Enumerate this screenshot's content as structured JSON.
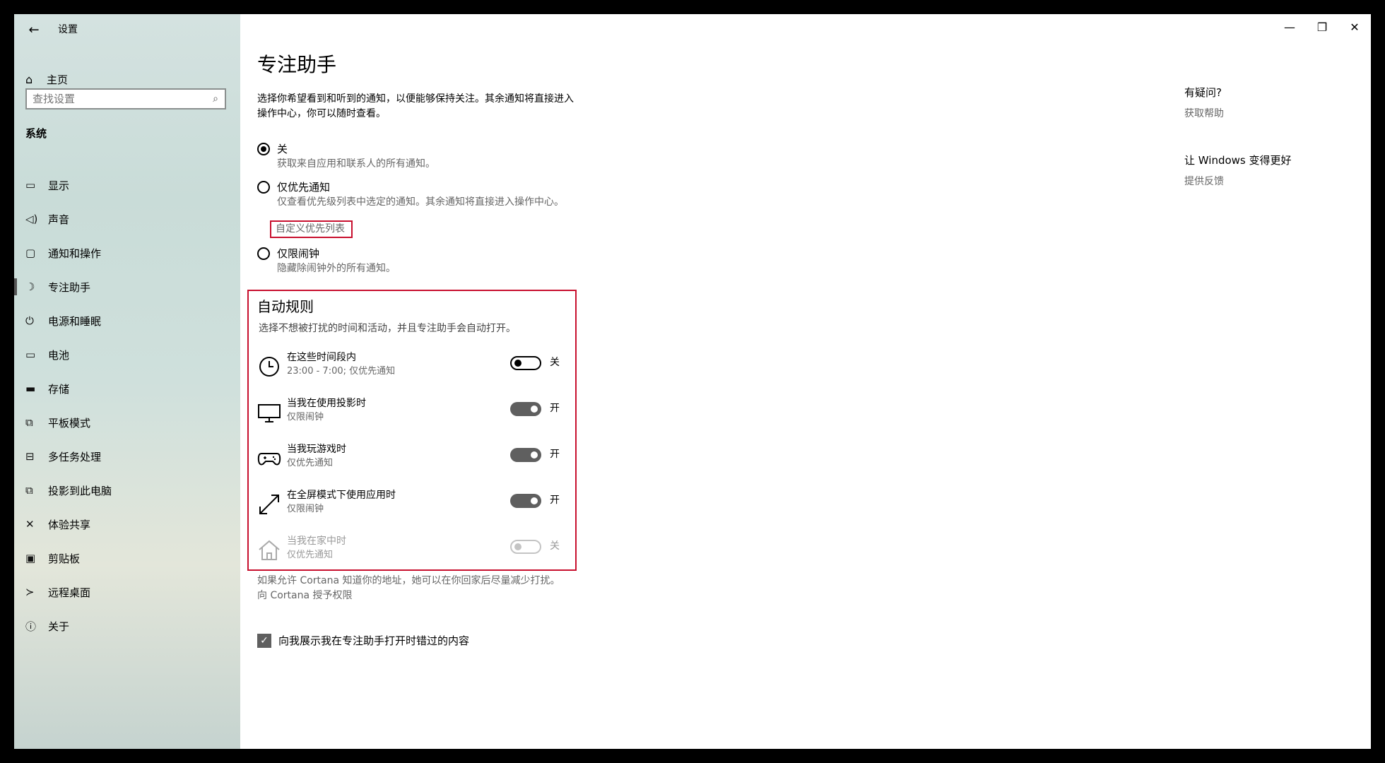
{
  "window": {
    "title": "设置",
    "controls": {
      "minimize": "—",
      "maximize": "❐",
      "close": "✕"
    }
  },
  "sidebar": {
    "home": "主页",
    "search_placeholder": "查找设置",
    "section": "系统",
    "items": [
      {
        "label": "显示",
        "icon": "display-icon",
        "glyph": "▭"
      },
      {
        "label": "声音",
        "icon": "sound-icon",
        "glyph": "◁)"
      },
      {
        "label": "通知和操作",
        "icon": "notification-icon",
        "glyph": "▢"
      },
      {
        "label": "专注助手",
        "icon": "moon-icon",
        "glyph": "☽",
        "active": true
      },
      {
        "label": "电源和睡眠",
        "icon": "power-icon",
        "glyph": "⏻"
      },
      {
        "label": "电池",
        "icon": "battery-icon",
        "glyph": "▭"
      },
      {
        "label": "存储",
        "icon": "storage-icon",
        "glyph": "▬"
      },
      {
        "label": "平板模式",
        "icon": "tablet-icon",
        "glyph": "⧉"
      },
      {
        "label": "多任务处理",
        "icon": "multitask-icon",
        "glyph": "⊟"
      },
      {
        "label": "投影到此电脑",
        "icon": "project-icon",
        "glyph": "⧉"
      },
      {
        "label": "体验共享",
        "icon": "share-icon",
        "glyph": "✕"
      },
      {
        "label": "剪贴板",
        "icon": "clipboard-icon",
        "glyph": "▣"
      },
      {
        "label": "远程桌面",
        "icon": "remote-icon",
        "glyph": "≻"
      },
      {
        "label": "关于",
        "icon": "info-icon",
        "glyph": "ⓘ"
      }
    ]
  },
  "main": {
    "title": "专注助手",
    "intro": "选择你希望看到和听到的通知，以便能够保持关注。其余通知将直接进入操作中心，你可以随时查看。",
    "options": [
      {
        "title": "关",
        "desc": "获取来自应用和联系人的所有通知。",
        "selected": true
      },
      {
        "title": "仅优先通知",
        "desc": "仅查看优先级列表中选定的通知。其余通知将直接进入操作中心。",
        "selected": false
      },
      {
        "title": "仅限闹钟",
        "desc": "隐藏除闹钟外的所有通知。",
        "selected": false
      }
    ],
    "customize_link": "自定义优先列表",
    "rules": {
      "title": "自动规则",
      "desc": "选择不想被打扰的时间和活动，并且专注助手会自动打开。",
      "items": [
        {
          "title": "在这些时间段内",
          "sub": "23:00 - 7:00; 仅优先通知",
          "state": "关",
          "on": false,
          "disabled": false
        },
        {
          "title": "当我在使用投影时",
          "sub": "仅限闹钟",
          "state": "开",
          "on": true,
          "disabled": false
        },
        {
          "title": "当我玩游戏时",
          "sub": "仅优先通知",
          "state": "开",
          "on": true,
          "disabled": false
        },
        {
          "title": "在全屏模式下使用应用时",
          "sub": "仅限闹钟",
          "state": "开",
          "on": true,
          "disabled": false
        },
        {
          "title": "当我在家中时",
          "sub": "仅优先通知",
          "state": "关",
          "on": false,
          "disabled": true
        }
      ]
    },
    "cortana_note": "如果允许 Cortana 知道你的地址，她可以在你回家后尽量减少打扰。",
    "cortana_link": "向 Cortana 授予权限",
    "checkbox_label": "向我展示我在专注助手打开时错过的内容",
    "checkbox_checked": true
  },
  "help": {
    "question": "有疑问?",
    "get_help": "获取帮助",
    "improve": "让 Windows 变得更好",
    "feedback": "提供反馈"
  }
}
